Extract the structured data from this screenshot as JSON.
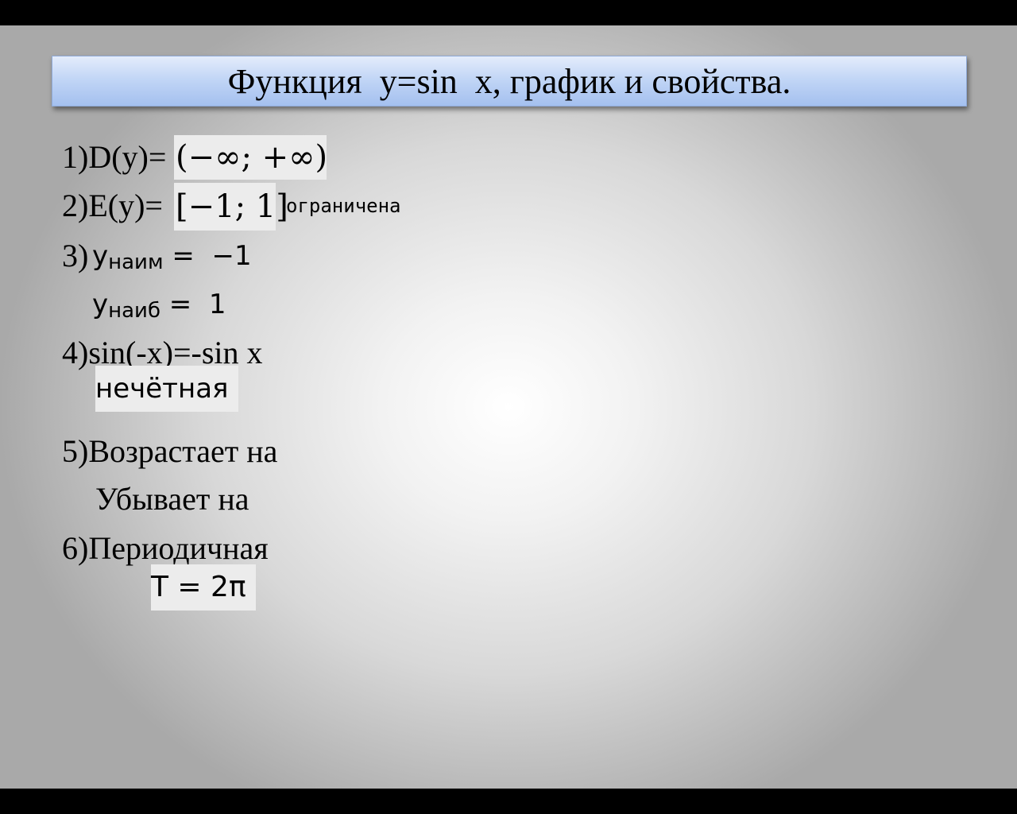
{
  "title": "Функция  y=sin  x, график и свойства.",
  "items": {
    "d_label": "1)D(y)=",
    "d_value": "(−∞; +∞)",
    "e_label": "2)E(y)=",
    "e_value": "[−1; 1]",
    "e_note": "ограничена",
    "min_label": "3)",
    "min_y": "y",
    "min_sub": "наим",
    "min_value": " =  −1",
    "max_y": "y",
    "max_sub": "наиб",
    "max_value": " =  1",
    "odd_label": "4)sin(-x)=-sin x",
    "odd_value": "нечётная",
    "inc_label": "5)Возрастает на",
    "dec_label": "Убывает на",
    "period_label": "6)Периодичная",
    "period_value": "T = 2π"
  }
}
